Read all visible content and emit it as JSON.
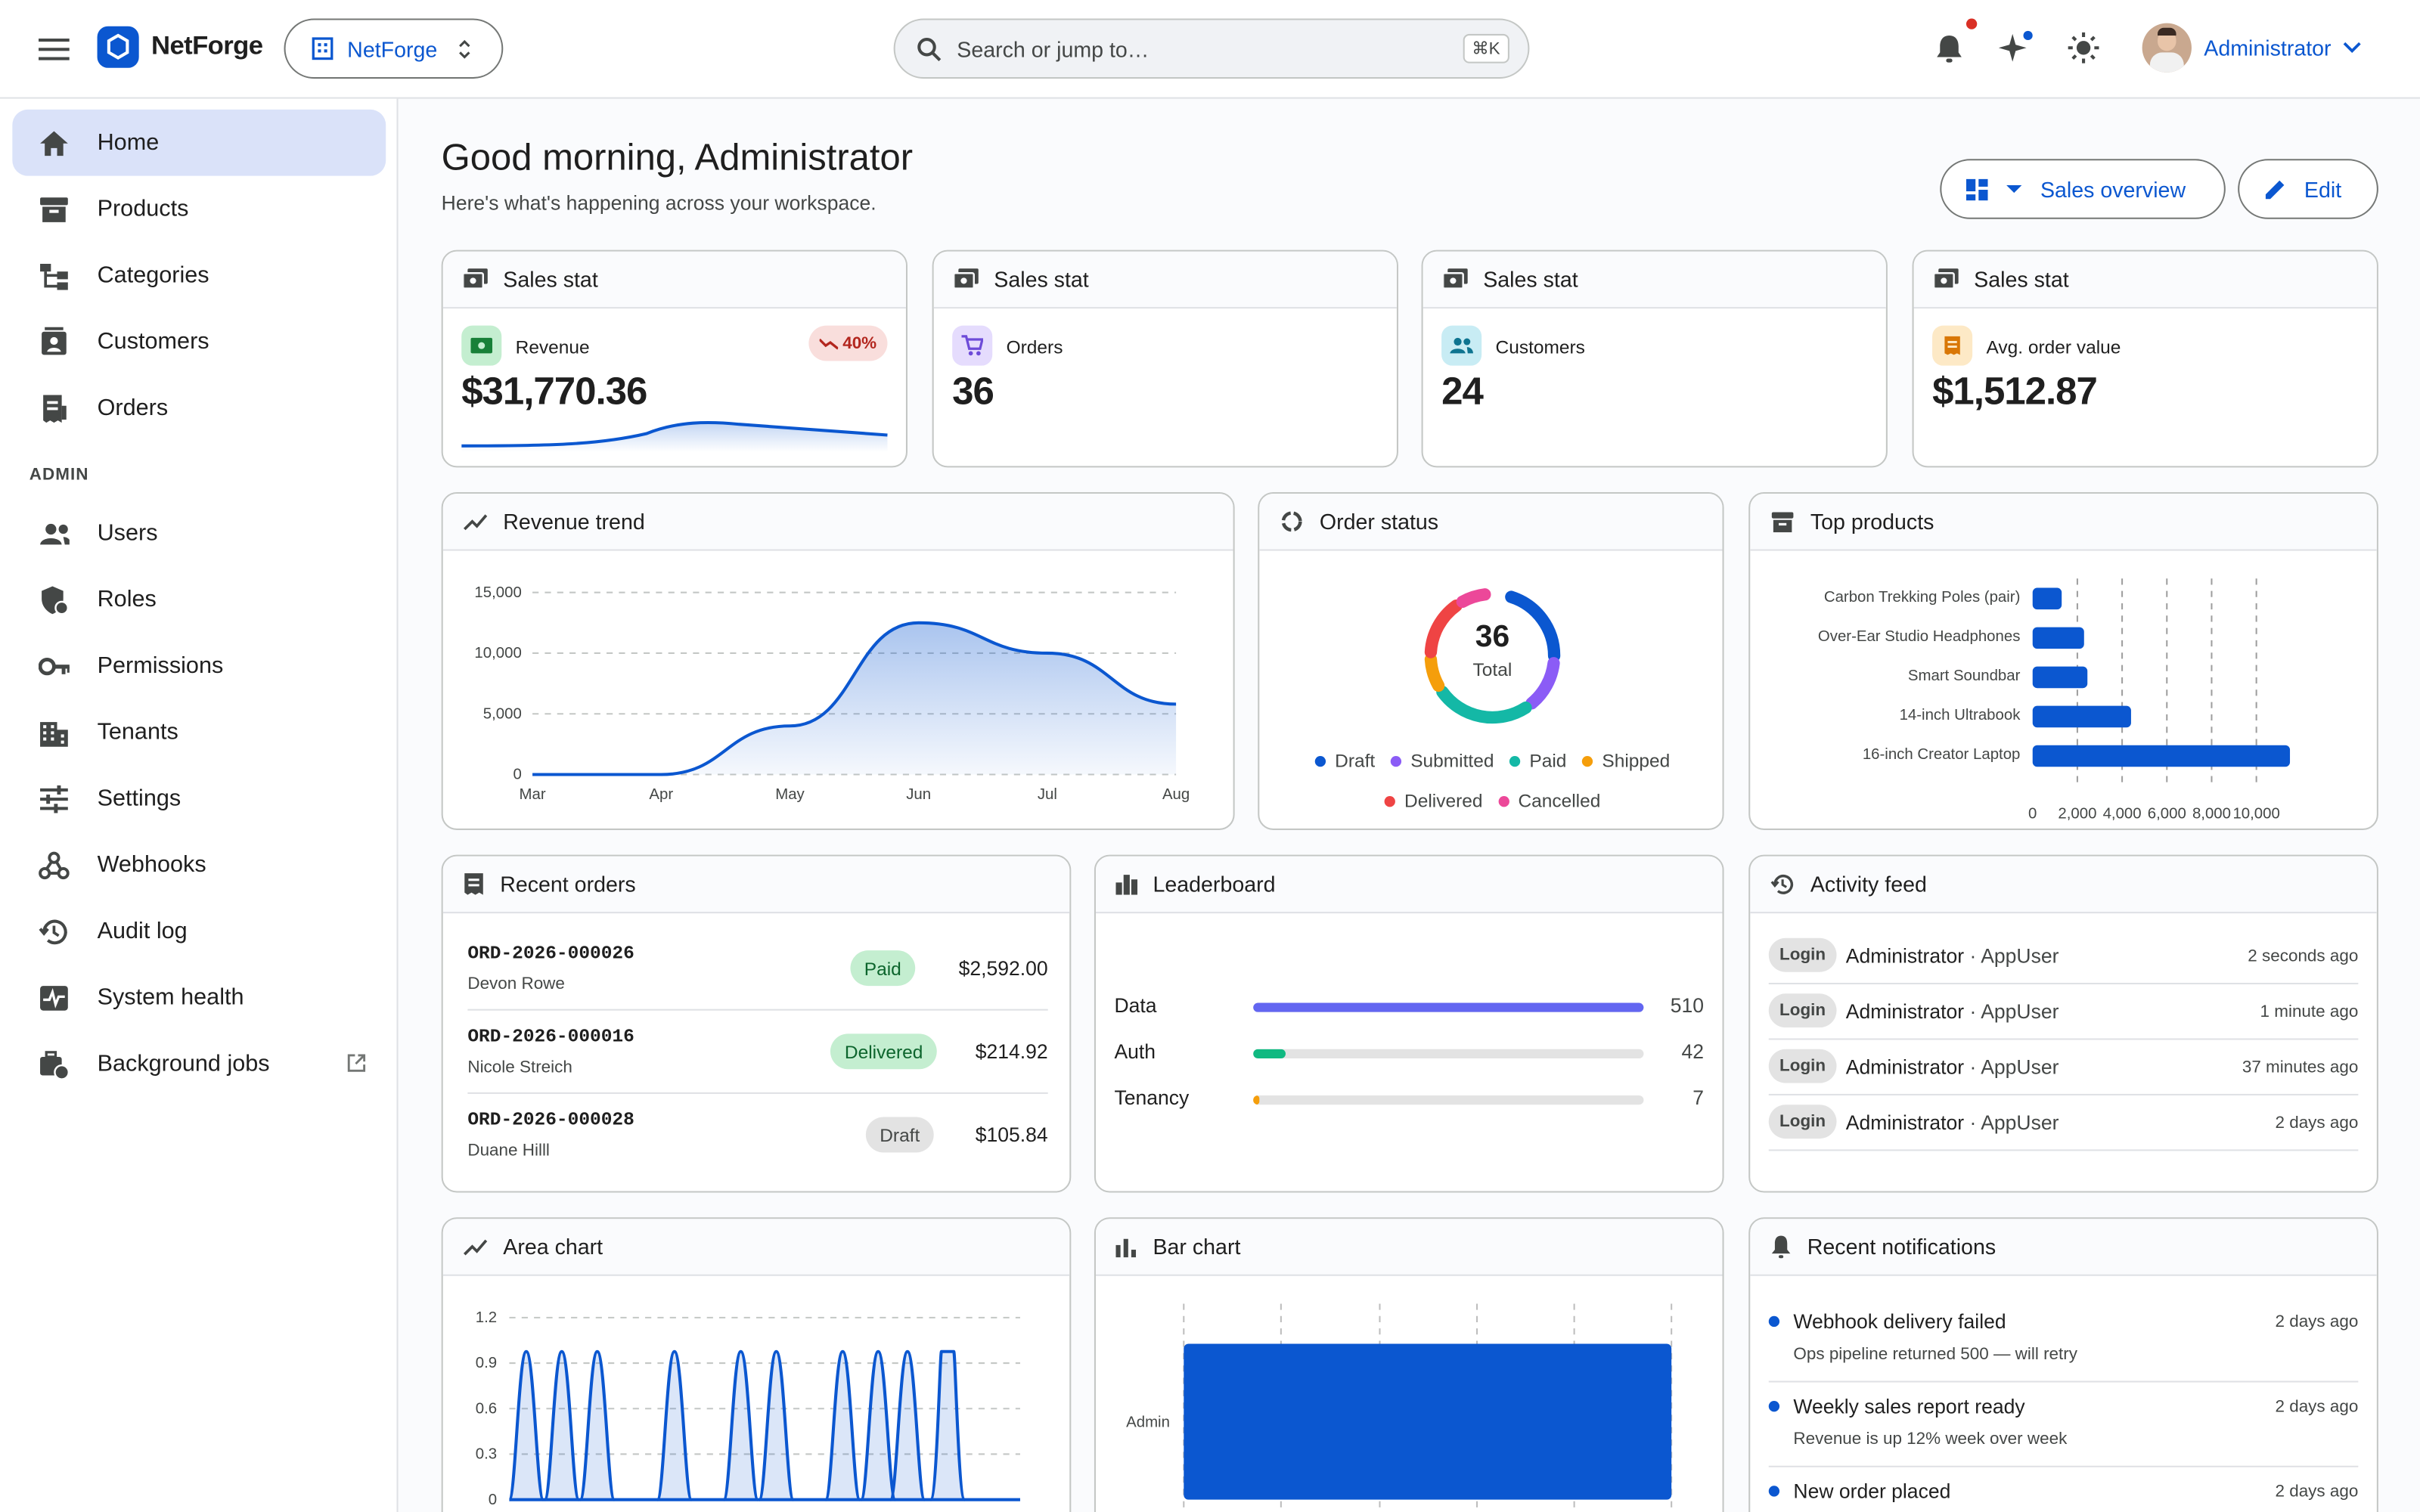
{
  "header": {
    "brand": "NetForge",
    "tenant": "NetForge",
    "search_placeholder": "Search or jump to…",
    "search_shortcut": "⌘K",
    "user": "Administrator"
  },
  "sidebar": {
    "items": [
      "Home",
      "Products",
      "Categories",
      "Customers",
      "Orders"
    ],
    "section": "ADMIN",
    "admin_items": [
      "Users",
      "Roles",
      "Permissions",
      "Tenants",
      "Settings",
      "Webhooks",
      "Audit log",
      "System health",
      "Background jobs"
    ]
  },
  "main": {
    "greeting": "Good morning, Administrator",
    "subtitle": "Here's what's happening across your workspace.",
    "view_button": "Sales overview",
    "edit_button": "Edit"
  },
  "stats": [
    {
      "title": "Sales stat",
      "label": "Revenue",
      "value": "$31,770.36",
      "badge": "40%",
      "icon": "money-icon"
    },
    {
      "title": "Sales stat",
      "label": "Orders",
      "value": "36",
      "icon": "cart-icon"
    },
    {
      "title": "Sales stat",
      "label": "Customers",
      "value": "24",
      "icon": "people-icon"
    },
    {
      "title": "Sales stat",
      "label": "Avg. order value",
      "value": "$1,512.87",
      "icon": "receipt-icon"
    }
  ],
  "revenue_trend": {
    "title": "Revenue trend",
    "chart_data": {
      "type": "area",
      "x": [
        "Mar",
        "Apr",
        "May",
        "Jun",
        "Jul",
        "Aug"
      ],
      "values": [
        0,
        0,
        4000,
        12500,
        10000,
        5800
      ],
      "yticks": [
        "15,000",
        "10,000",
        "5,000",
        "0"
      ],
      "ylim": [
        0,
        15000
      ]
    }
  },
  "order_status": {
    "title": "Order status",
    "total": "36",
    "total_label": "Total",
    "legend": [
      "Draft",
      "Submitted",
      "Paid",
      "Shipped",
      "Delivered",
      "Cancelled"
    ],
    "colors": [
      "#0b57d0",
      "#8b5cf6",
      "#14b8a6",
      "#f59e0b",
      "#ef4444",
      "#ec4899"
    ]
  },
  "top_products": {
    "title": "Top products",
    "chart_data": {
      "type": "bar",
      "categories": [
        "Carbon Trekking Poles (pair)",
        "Over-Ear Studio Headphones",
        "Smart Soundbar",
        "14-inch Ultrabook",
        "16-inch Creator Laptop"
      ],
      "values": [
        1300,
        2300,
        2450,
        4400,
        11500
      ],
      "xticks": [
        "0",
        "2,000",
        "4,000",
        "6,000",
        "8,000",
        "10,000"
      ]
    }
  },
  "recent_orders": {
    "title": "Recent orders",
    "rows": [
      {
        "id": "ORD-2026-000026",
        "name": "Devon Rowe",
        "status": "Paid",
        "amount": "$2,592.00"
      },
      {
        "id": "ORD-2026-000016",
        "name": "Nicole Streich",
        "status": "Delivered",
        "amount": "$214.92"
      },
      {
        "id": "ORD-2026-000028",
        "name": "Duane Hilll",
        "status": "Draft",
        "amount": "$105.84"
      }
    ]
  },
  "leaderboard": {
    "title": "Leaderboard",
    "rows": [
      {
        "name": "Data",
        "value": "510"
      },
      {
        "name": "Auth",
        "value": "42"
      },
      {
        "name": "Tenancy",
        "value": "7"
      }
    ]
  },
  "activity": {
    "title": "Activity feed",
    "rows": [
      {
        "tag": "Login",
        "who": "Administrator",
        "what": "AppUser",
        "time": "2 seconds ago"
      },
      {
        "tag": "Login",
        "who": "Administrator",
        "what": "AppUser",
        "time": "1 minute ago"
      },
      {
        "tag": "Login",
        "who": "Administrator",
        "what": "AppUser",
        "time": "37 minutes ago"
      },
      {
        "tag": "Login",
        "who": "Administrator",
        "what": "AppUser",
        "time": "2 days ago"
      }
    ]
  },
  "area_chart": {
    "title": "Area chart",
    "yticks": [
      "1.2",
      "0.9",
      "0.6",
      "0.3",
      "0"
    ]
  },
  "bar_chart": {
    "title": "Bar chart",
    "category": "Admin"
  },
  "notifications": {
    "title": "Recent notifications",
    "rows": [
      {
        "title": "Webhook delivery failed",
        "desc": "Ops pipeline returned 500 — will retry",
        "time": "2 days ago"
      },
      {
        "title": "Weekly sales report ready",
        "desc": "Revenue is up 12% week over week",
        "time": "2 days ago"
      },
      {
        "title": "New order placed",
        "desc": "",
        "time": "2 days ago"
      }
    ]
  }
}
